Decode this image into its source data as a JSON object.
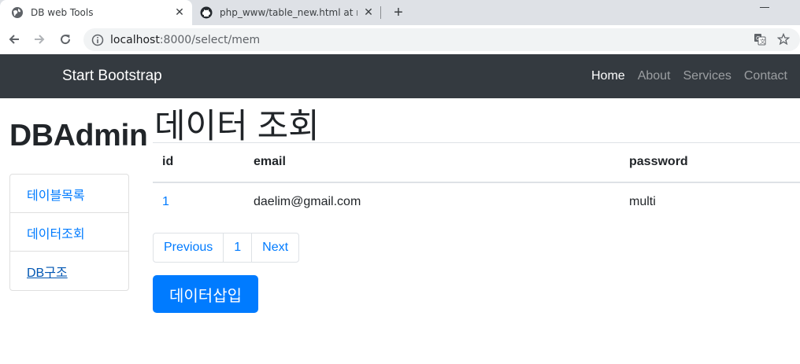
{
  "browser": {
    "tabs": [
      {
        "title": "DB web Tools",
        "icon": "globe-icon",
        "active": true
      },
      {
        "title": "php_www/table_new.html at ma",
        "icon": "github-icon",
        "active": false
      }
    ],
    "new_tab_icon": "plus-icon",
    "url_host": "localhost",
    "url_path": ":8000/select/mem"
  },
  "navbar": {
    "brand": "Start Bootstrap",
    "links": [
      {
        "label": "Home",
        "active": true
      },
      {
        "label": "About",
        "active": false
      },
      {
        "label": "Services",
        "active": false
      },
      {
        "label": "Contact",
        "active": false
      }
    ]
  },
  "sidebar": {
    "title": "DBAdmin",
    "items": [
      {
        "label": "테이블목록"
      },
      {
        "label": "데이터조회"
      },
      {
        "label": "DB구조"
      }
    ]
  },
  "main": {
    "title": "데이터 조회",
    "table": {
      "headers": [
        "id",
        "email",
        "password"
      ],
      "rows": [
        [
          "1",
          "daelim@gmail.com",
          "multi"
        ]
      ]
    },
    "pagination": {
      "previous": "Previous",
      "page": "1",
      "next": "Next"
    },
    "insert_button": "데이터삽입"
  },
  "colors": {
    "navbar_bg": "#343a40",
    "link": "#007bff",
    "primary_button": "#007bff",
    "tabstrip_bg": "#dee1e6"
  }
}
